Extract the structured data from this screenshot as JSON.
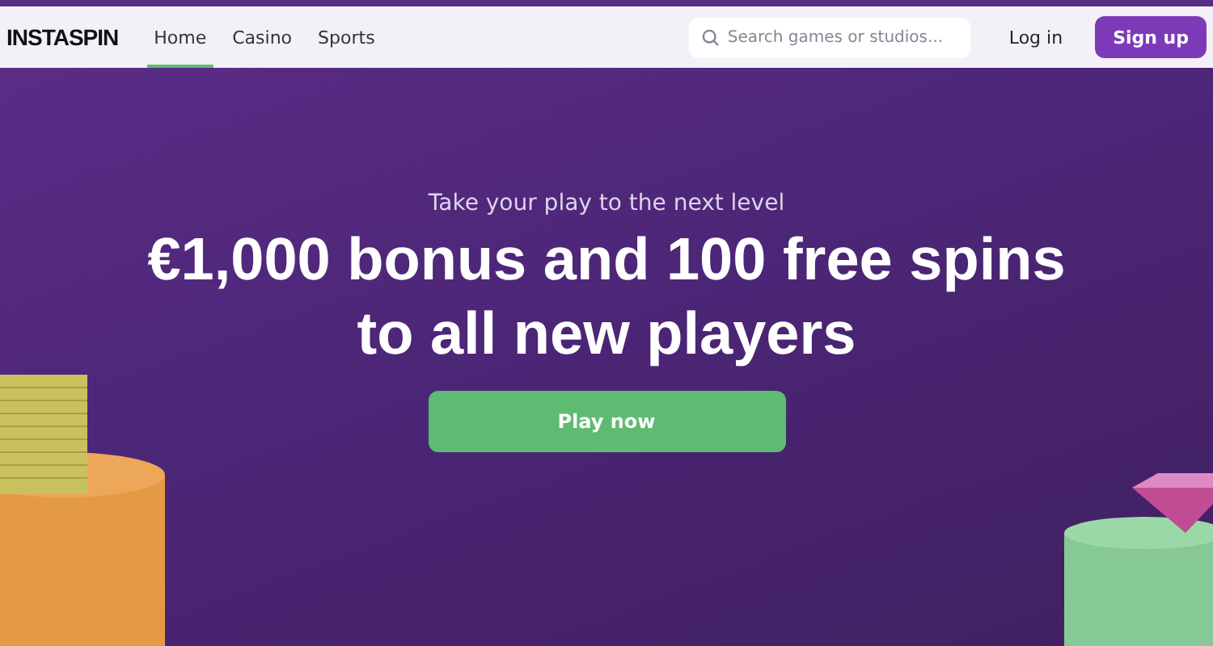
{
  "logo": "INSTASPIN",
  "nav": [
    {
      "label": "Home",
      "selected": true
    },
    {
      "label": "Casino",
      "selected": false
    },
    {
      "label": "Sports",
      "selected": false
    }
  ],
  "search": {
    "placeholder": "Search games or studios..."
  },
  "login": "Log in",
  "signup": "Sign up",
  "hero": {
    "subtitle": "Take your play to the next level",
    "headline": "€1,000 bonus and 100 free spins to all new players",
    "cta": "Play now"
  }
}
